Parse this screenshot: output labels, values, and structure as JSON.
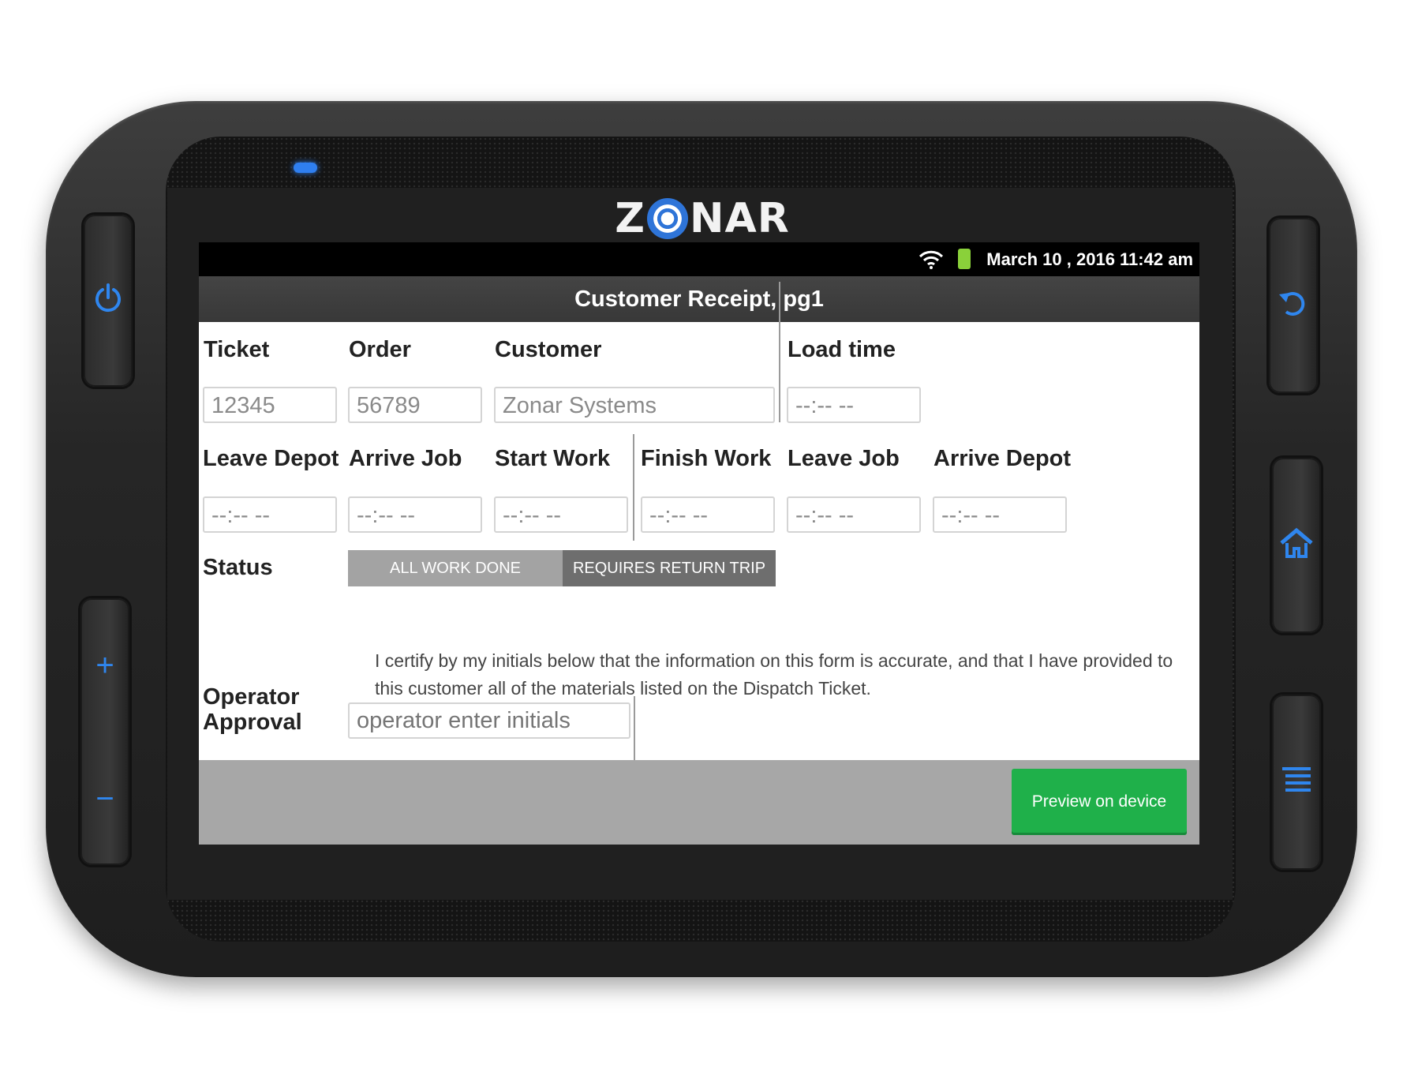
{
  "device": {
    "brand": "ZONAR",
    "buttons": [
      "power-icon",
      "plus-icon",
      "minus-icon",
      "back-icon",
      "home-icon",
      "menu-icon"
    ]
  },
  "statusbar": {
    "datetime": "March 10 , 2016 11:42 am",
    "icons": [
      "wifi-icon",
      "battery-icon"
    ]
  },
  "page": {
    "title": "Customer Receipt, pg1"
  },
  "form": {
    "ticket": {
      "label": "Ticket",
      "value": "12345"
    },
    "order": {
      "label": "Order",
      "value": "56789"
    },
    "customer": {
      "label": "Customer",
      "value": "Zonar Systems"
    },
    "load_time": {
      "label": "Load time",
      "value": "--:-- --"
    },
    "leave_depot": {
      "label": "Leave Depot",
      "value": "--:-- --"
    },
    "arrive_job": {
      "label": "Arrive Job",
      "value": "--:-- --"
    },
    "start_work": {
      "label": "Start Work",
      "value": "--:-- --"
    },
    "finish_work": {
      "label": "Finish Work",
      "value": "--:-- --"
    },
    "leave_job": {
      "label": "Leave Job",
      "value": "--:-- --"
    },
    "arrive_depot": {
      "label": "Arrive Depot",
      "value": "--:-- --"
    },
    "status": {
      "label": "Status",
      "options": [
        "ALL WORK DONE",
        "REQUIRES RETURN TRIP"
      ],
      "selected": "REQUIRES RETURN TRIP"
    },
    "operator_approval": {
      "label_line1": "Operator",
      "label_line2": "Approval",
      "certify_text": "I certify by my initials below that the information on this form is accurate, and that I have provided to this customer all of the materials listed on the Dispatch Ticket.",
      "placeholder": "operator enter initials"
    }
  },
  "footer": {
    "preview_label": "Preview on device"
  },
  "colors": {
    "accent_blue": "#2f86ee",
    "button_green": "#1fb04a",
    "selected_segment": "#6e6e6e",
    "unselected_segment": "#a3a3a3"
  }
}
